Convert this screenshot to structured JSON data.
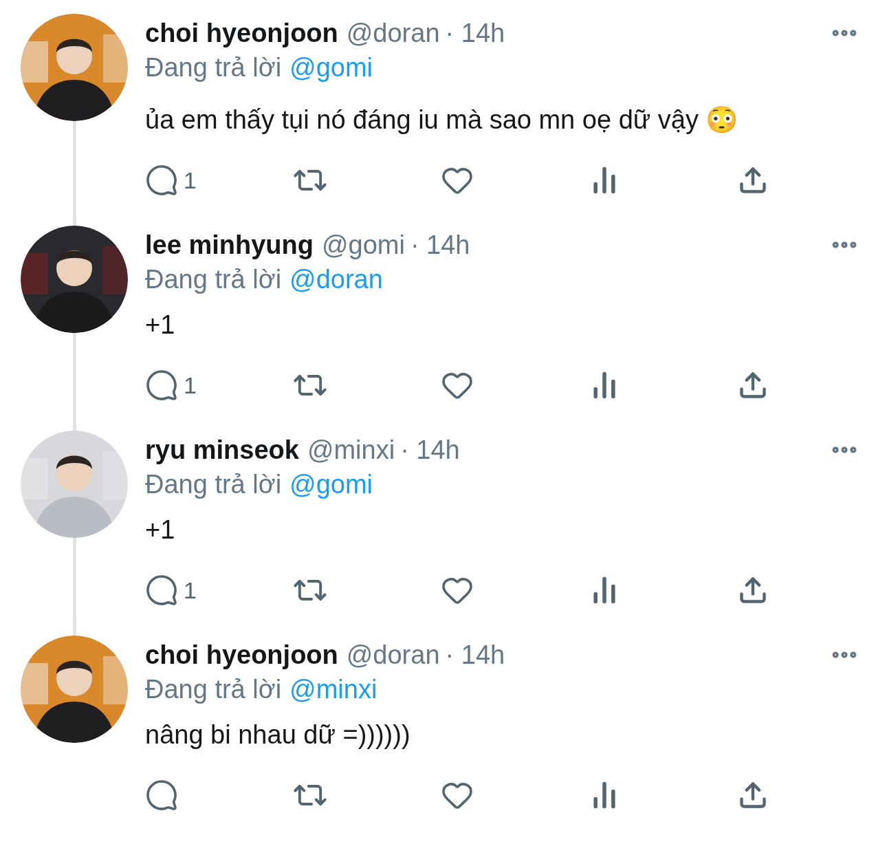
{
  "tweets": [
    {
      "name": "choi hyeonjoon",
      "handle": "@doran",
      "time": "· 14h",
      "reply_prefix": "Đang trả lời",
      "reply_to": "@gomi",
      "body": "ủa em thấy tụi nó đáng iu mà sao mn oẹ dữ vậy 😳",
      "reply_count": "1"
    },
    {
      "name": "lee minhyung",
      "handle": "@gomi",
      "time": "· 14h",
      "reply_prefix": "Đang trả lời",
      "reply_to": "@doran",
      "body": "+1",
      "reply_count": "1"
    },
    {
      "name": "ryu minseok",
      "handle": "@minxi",
      "time": "· 14h",
      "reply_prefix": "Đang trả lời",
      "reply_to": "@gomi",
      "body": "+1",
      "reply_count": "1"
    },
    {
      "name": "choi hyeonjoon",
      "handle": "@doran",
      "time": "· 14h",
      "reply_prefix": "Đang trả lời",
      "reply_to": "@minxi",
      "body": "nâng bi nhau dữ =))))))"
    }
  ]
}
